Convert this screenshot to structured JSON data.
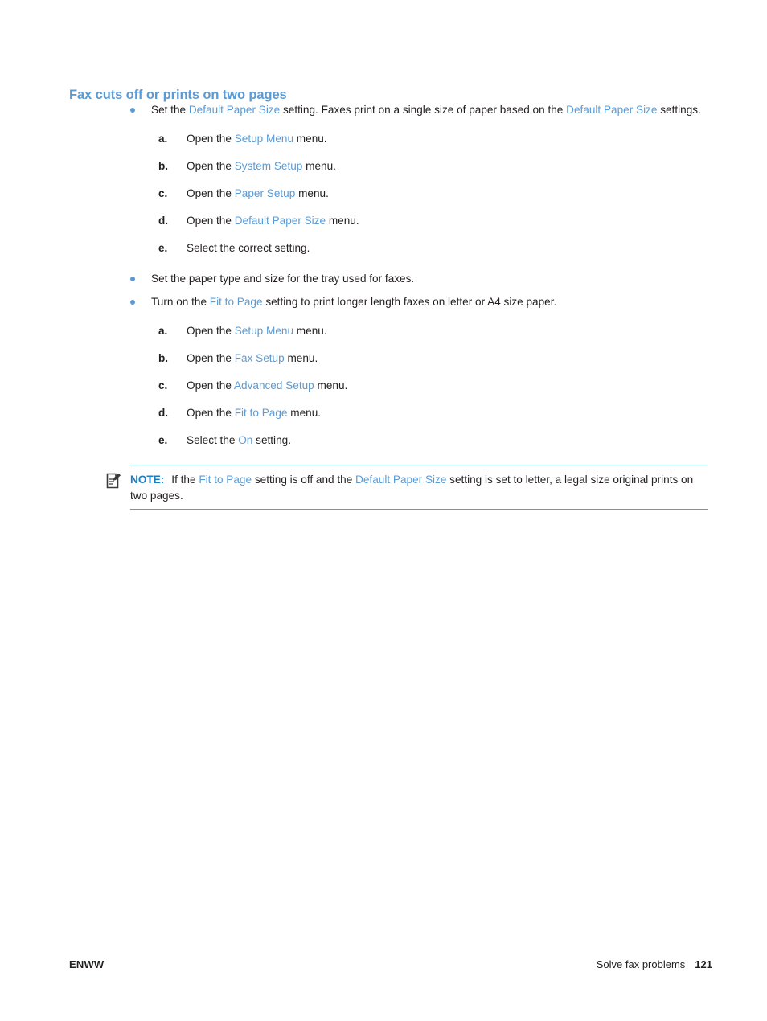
{
  "heading": "Fax cuts off or prints on two pages",
  "colors": {
    "heading_blue": "#5b9bd5",
    "link_blue": "#5b9bd5",
    "note_label_blue": "#1b7cc2",
    "body_black": "#231f20",
    "rule_blue": "#5b9bd5"
  },
  "bullets": [
    {
      "segments": [
        {
          "text": "Set the ",
          "style": "plain"
        },
        {
          "text": "Default Paper Size",
          "style": "ref"
        },
        {
          "text": " setting. Faxes print on a single size of paper based on the ",
          "style": "plain"
        },
        {
          "text": "Default Paper Size",
          "style": "ref"
        },
        {
          "text": " settings.",
          "style": "plain"
        }
      ],
      "substeps": [
        {
          "marker": "a.",
          "segments": [
            {
              "text": "Open the ",
              "style": "plain"
            },
            {
              "text": "Setup Menu",
              "style": "ref"
            },
            {
              "text": " menu.",
              "style": "plain"
            }
          ]
        },
        {
          "marker": "b.",
          "segments": [
            {
              "text": "Open the ",
              "style": "plain"
            },
            {
              "text": "System Setup",
              "style": "ref"
            },
            {
              "text": " menu.",
              "style": "plain"
            }
          ]
        },
        {
          "marker": "c.",
          "segments": [
            {
              "text": "Open the ",
              "style": "plain"
            },
            {
              "text": "Paper Setup",
              "style": "ref"
            },
            {
              "text": " menu.",
              "style": "plain"
            }
          ]
        },
        {
          "marker": "d.",
          "segments": [
            {
              "text": "Open the ",
              "style": "plain"
            },
            {
              "text": "Default Paper Size",
              "style": "ref"
            },
            {
              "text": " menu.",
              "style": "plain"
            }
          ]
        },
        {
          "marker": "e.",
          "segments": [
            {
              "text": "Select the correct setting.",
              "style": "plain"
            }
          ]
        }
      ]
    },
    {
      "segments": [
        {
          "text": "Set the paper type and size for the tray used for faxes.",
          "style": "plain"
        }
      ],
      "substeps": []
    },
    {
      "segments": [
        {
          "text": "Turn on the ",
          "style": "plain"
        },
        {
          "text": "Fit to Page",
          "style": "ref"
        },
        {
          "text": " setting to print longer length faxes on letter or A4 size paper.",
          "style": "plain"
        }
      ],
      "substeps": [
        {
          "marker": "a.",
          "segments": [
            {
              "text": "Open the ",
              "style": "plain"
            },
            {
              "text": "Setup Menu",
              "style": "ref"
            },
            {
              "text": " menu.",
              "style": "plain"
            }
          ]
        },
        {
          "marker": "b.",
          "segments": [
            {
              "text": "Open the ",
              "style": "plain"
            },
            {
              "text": "Fax Setup",
              "style": "ref"
            },
            {
              "text": " menu.",
              "style": "plain"
            }
          ]
        },
        {
          "marker": "c.",
          "segments": [
            {
              "text": "Open the ",
              "style": "plain"
            },
            {
              "text": "Advanced Setup",
              "style": "ref"
            },
            {
              "text": " menu.",
              "style": "plain"
            }
          ]
        },
        {
          "marker": "d.",
          "segments": [
            {
              "text": "Open the ",
              "style": "plain"
            },
            {
              "text": "Fit to Page",
              "style": "ref"
            },
            {
              "text": " menu.",
              "style": "plain"
            }
          ]
        },
        {
          "marker": "e.",
          "segments": [
            {
              "text": "Select the ",
              "style": "plain"
            },
            {
              "text": "On",
              "style": "ref"
            },
            {
              "text": " setting.",
              "style": "plain"
            }
          ]
        }
      ]
    }
  ],
  "note": {
    "icon": "note-pencil-icon",
    "label": "NOTE:",
    "segments": [
      {
        "text": "If the ",
        "style": "plain"
      },
      {
        "text": "Fit to Page",
        "style": "ref"
      },
      {
        "text": " setting is off and the ",
        "style": "plain"
      },
      {
        "text": "Default Paper Size",
        "style": "ref"
      },
      {
        "text": " setting is set to letter, a legal size original prints on two pages.",
        "style": "plain"
      }
    ]
  },
  "footer": {
    "left": "ENWW",
    "section": "Solve fax problems",
    "page_number": "121"
  }
}
